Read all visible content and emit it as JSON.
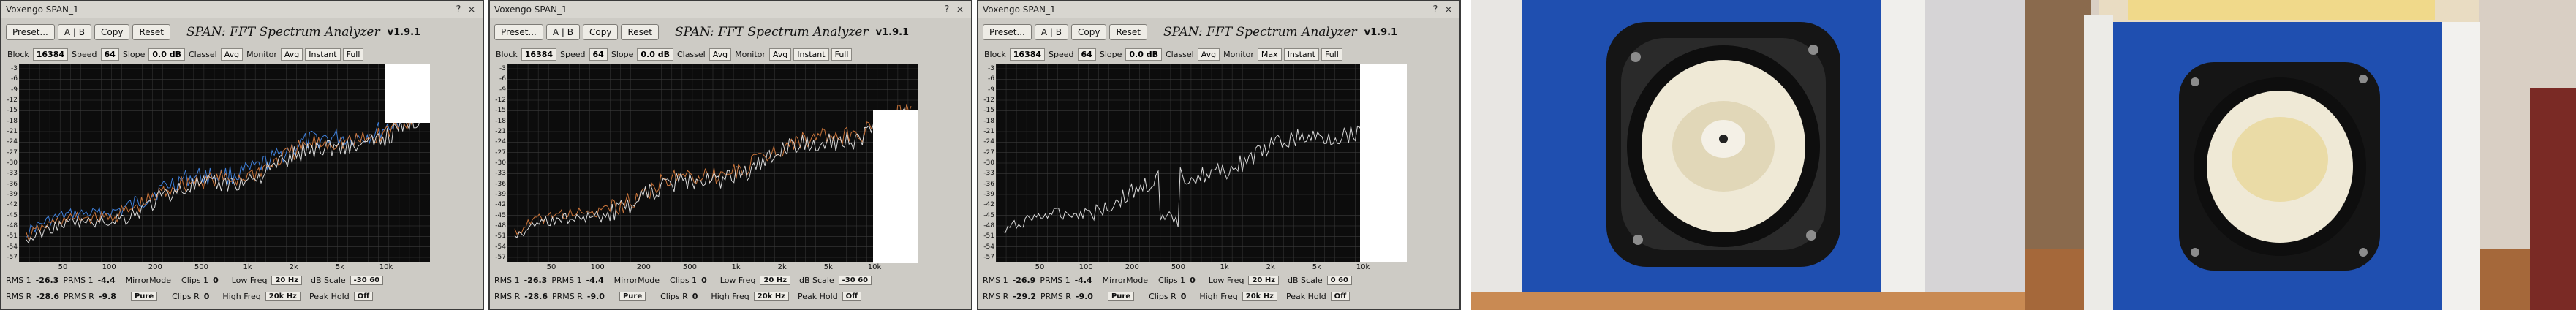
{
  "windows": [
    {
      "title": "Voxengo SPAN_1",
      "title_buttons": [
        "?",
        "×"
      ],
      "buttons": [
        "Preset...",
        "A | B",
        "Copy",
        "Reset"
      ],
      "app_name": "SPAN: FFT Spectrum Analyzer",
      "version": "v1.9.1",
      "controls": [
        {
          "label": "Block",
          "value": "16384"
        },
        {
          "label": "Speed",
          "value": "64"
        },
        {
          "label": "Slope",
          "value": "0.0 dB"
        },
        {
          "label": "Classel",
          "value": "Avg"
        },
        {
          "label": "Monitor",
          "value": "Avg"
        },
        {
          "label": "",
          "value": "Instant"
        },
        {
          "label": "",
          "value": "Full"
        }
      ],
      "y_ticks": [
        "-3",
        "-6",
        "-9",
        "-12",
        "-15",
        "-18",
        "-21",
        "-24",
        "-27",
        "-30",
        "-33",
        "-36",
        "-39",
        "-42",
        "-45",
        "-48",
        "-51",
        "-54",
        "-57"
      ],
      "x_ticks": [
        "50",
        "100",
        "200",
        "500",
        "1k",
        "2k",
        "5k",
        "10k"
      ],
      "rms1": {
        "label": "RMS 1",
        "value": "-26.3",
        "prms_label": "PRMS 1",
        "prms": "-4.4"
      },
      "rms2": {
        "label": "RMS R",
        "value": "-28.6",
        "prms_label": "PRMS R",
        "prms": "-9.8"
      },
      "mirror_label": "MirrorMode",
      "mirror_value": "Pure",
      "clips1": {
        "label": "Clips 1",
        "value": "0"
      },
      "clips2": {
        "label": "Clips R",
        "value": "0"
      },
      "lowfreq": {
        "label": "Low Freq",
        "value": "20 Hz"
      },
      "highfreq": {
        "label": "High Freq",
        "value": "20k Hz"
      },
      "dbscale": {
        "label": "dB Scale",
        "value": "-30 60"
      },
      "peakhold": {
        "label": "Peak Hold",
        "value": "Off"
      },
      "traces": [
        "blue",
        "orange",
        "white"
      ]
    },
    {
      "title": "Voxengo SPAN_1",
      "title_buttons": [
        "?",
        "×"
      ],
      "buttons": [
        "Preset...",
        "A | B",
        "Copy",
        "Reset"
      ],
      "app_name": "SPAN: FFT Spectrum Analyzer",
      "version": "v1.9.1",
      "controls": [
        {
          "label": "Block",
          "value": "16384"
        },
        {
          "label": "Speed",
          "value": "64"
        },
        {
          "label": "Slope",
          "value": "0.0 dB"
        },
        {
          "label": "Classel",
          "value": "Avg"
        },
        {
          "label": "Monitor",
          "value": "Avg"
        },
        {
          "label": "",
          "value": "Instant"
        },
        {
          "label": "",
          "value": "Full"
        }
      ],
      "y_ticks": [
        "-3",
        "-6",
        "-9",
        "-12",
        "-15",
        "-18",
        "-21",
        "-24",
        "-27",
        "-30",
        "-33",
        "-36",
        "-39",
        "-42",
        "-45",
        "-48",
        "-51",
        "-54",
        "-57"
      ],
      "x_ticks": [
        "50",
        "100",
        "200",
        "500",
        "1k",
        "2k",
        "5k",
        "10k"
      ],
      "rms1": {
        "label": "RMS 1",
        "value": "-26.3",
        "prms_label": "PRMS 1",
        "prms": "-4.4"
      },
      "rms2": {
        "label": "RMS R",
        "value": "-28.6",
        "prms_label": "PRMS R",
        "prms": "-9.0"
      },
      "mirror_label": "MirrorMode",
      "mirror_value": "Pure",
      "clips1": {
        "label": "Clips 1",
        "value": "0"
      },
      "clips2": {
        "label": "Clips R",
        "value": "0"
      },
      "lowfreq": {
        "label": "Low Freq",
        "value": "20 Hz"
      },
      "highfreq": {
        "label": "High Freq",
        "value": "20k Hz"
      },
      "dbscale": {
        "label": "dB Scale",
        "value": "-30 60"
      },
      "peakhold": {
        "label": "Peak Hold",
        "value": "Off"
      },
      "traces": [
        "orange",
        "white"
      ]
    },
    {
      "title": "Voxengo SPAN_1",
      "title_buttons": [
        "?",
        "×"
      ],
      "buttons": [
        "Preset...",
        "A | B",
        "Copy",
        "Reset"
      ],
      "app_name": "SPAN: FFT Spectrum Analyzer",
      "version": "v1.9.1",
      "controls": [
        {
          "label": "Block",
          "value": "16384"
        },
        {
          "label": "Speed",
          "value": "64"
        },
        {
          "label": "Slope",
          "value": "0.0 dB"
        },
        {
          "label": "Classel",
          "value": "Avg"
        },
        {
          "label": "Monitor",
          "value": "Max"
        },
        {
          "label": "",
          "value": "Instant"
        },
        {
          "label": "",
          "value": "Full"
        }
      ],
      "y_ticks": [
        "-3",
        "-6",
        "-9",
        "-12",
        "-15",
        "-18",
        "-21",
        "-24",
        "-27",
        "-30",
        "-33",
        "-36",
        "-39",
        "-42",
        "-45",
        "-48",
        "-51",
        "-54",
        "-57"
      ],
      "x_ticks": [
        "50",
        "100",
        "200",
        "500",
        "1k",
        "2k",
        "5k",
        "10k"
      ],
      "rms1": {
        "label": "RMS 1",
        "value": "-26.9",
        "prms_label": "PRMS 1",
        "prms": "-4.4"
      },
      "rms2": {
        "label": "RMS R",
        "value": "-29.2",
        "prms_label": "PRMS R",
        "prms": "-9.0"
      },
      "mirror_label": "MirrorMode",
      "mirror_value": "Pure",
      "clips1": {
        "label": "Clips 1",
        "value": "0"
      },
      "clips2": {
        "label": "Clips R",
        "value": "0"
      },
      "lowfreq": {
        "label": "Low Freq",
        "value": "20 Hz"
      },
      "highfreq": {
        "label": "High Freq",
        "value": "20k Hz"
      },
      "dbscale": {
        "label": "dB Scale",
        "value": "0 60"
      },
      "peakhold": {
        "label": "Peak Hold",
        "value": "Off"
      },
      "traces": [
        "white"
      ]
    }
  ],
  "photos": [
    {
      "subject": "speaker-front",
      "colors": {
        "cabinet": "#1f4fb0",
        "surround": "#1a1a1a",
        "cone": "#efe9d6",
        "wall": "#e9e9ea"
      }
    },
    {
      "subject": "speaker-open-top",
      "colors": {
        "cabinet": "#1f4fb0",
        "surround": "#1a1a1a",
        "cone": "#efe9d6",
        "wall": "#d8cfc4"
      }
    }
  ],
  "trace_colors": {
    "blue": "#3f7fd8",
    "orange": "#c9743a",
    "white": "#d8d8d8",
    "grid": "#3a3a3a"
  }
}
